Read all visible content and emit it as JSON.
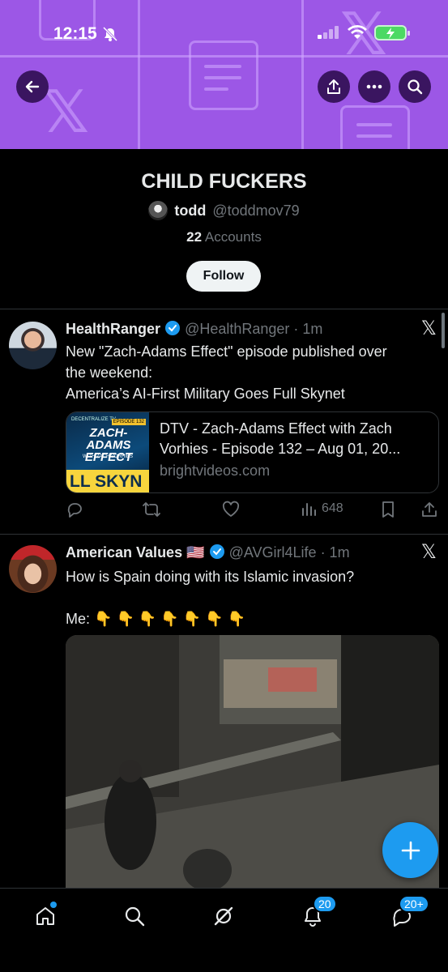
{
  "status_bar": {
    "time": "12:15"
  },
  "header": {
    "list_title": "CHILD FUCKERS",
    "owner_name": "todd",
    "owner_handle": "@toddmov79",
    "accounts_count": "22",
    "accounts_label": "Accounts",
    "follow_label": "Follow"
  },
  "tweets": [
    {
      "name": "HealthRanger",
      "handle": "@HealthRanger",
      "time": "· 1m",
      "text_lines": [
        "New \"Zach-Adams Effect\" episode published over",
        "the weekend:",
        "America’s AI-First Military Goes Full Skynet"
      ],
      "card": {
        "thumb_top_left": "DECENTRALIZE TV",
        "thumb_episode": "EPISODE 132",
        "thumb_title": "ZACH-ADAMS EFFECT",
        "thumb_subtitle": "WITH ZACH VORHIES",
        "thumb_banner": "LL SKYN",
        "title": "DTV - Zach-Adams Effect with Zach Vorhies - Episode 132 – Aug 01, 20...",
        "domain": "brightvideos.com"
      },
      "views": "648"
    },
    {
      "name": "American Values",
      "flag": "🇺🇸",
      "handle": "@AVGirl4Life",
      "time": "· 1m",
      "text_line1": "How is Spain doing with its Islamic invasion?",
      "text_line2": "Me:",
      "emoji_row": "👇 👇 👇 👇 👇 👇 👇"
    }
  ],
  "tabbar": {
    "notifications_badge": "20",
    "messages_badge": "20+"
  },
  "icons": {
    "back": "arrow-left-icon",
    "share": "share-icon",
    "more": "more-icon",
    "search": "search-icon",
    "x_logo": "x-logo-icon",
    "reply": "reply-icon",
    "retweet": "retweet-icon",
    "like": "heart-icon",
    "views": "views-icon",
    "bookmark": "bookmark-icon",
    "compose": "plus-icon",
    "home": "home-icon",
    "explore": "search-icon",
    "grok": "grok-icon",
    "notifications": "bell-icon",
    "messages": "messages-icon"
  },
  "colors": {
    "banner": "#9c57e6",
    "accent": "#1d9bf0",
    "background": "#000000",
    "muted_text": "#71767b"
  }
}
